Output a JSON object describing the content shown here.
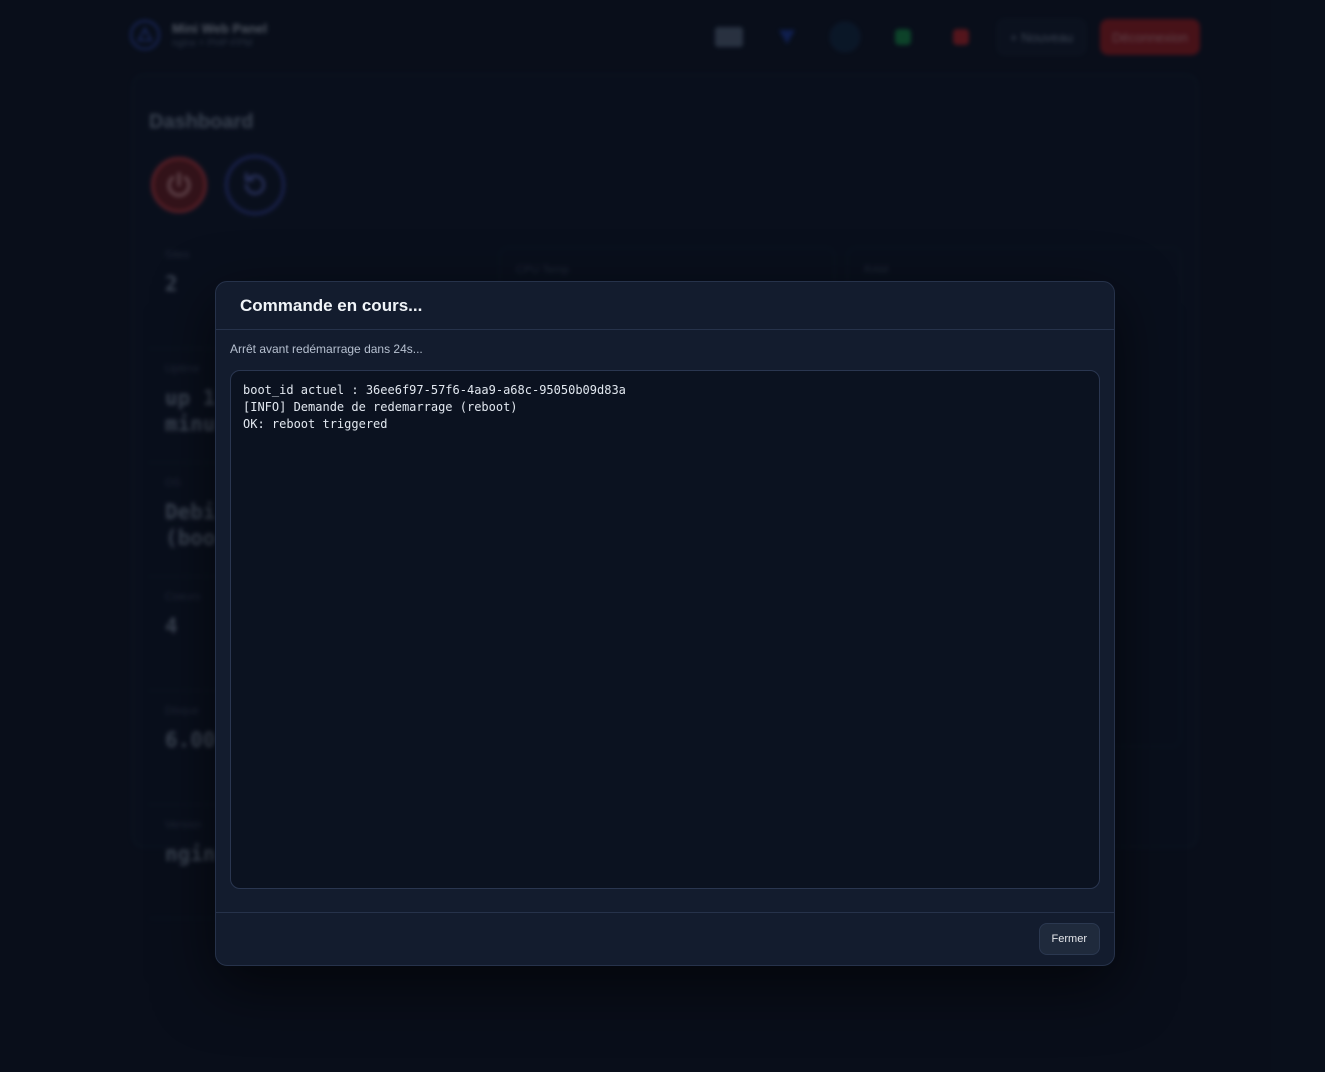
{
  "app": {
    "brand_title": "Mini Web Panel",
    "brand_subtitle": "nginx + PHP-FPM",
    "new_button": "+ Nouveau",
    "logout_button": "Déconnexion",
    "dashboard_title": "Dashboard",
    "cards": [
      {
        "label": "Sites",
        "value": "2"
      },
      {
        "label": "Uptime",
        "value": "up 1\nminu"
      },
      {
        "label": "OS",
        "value": "Debi\n(boo"
      },
      {
        "label": "Coeurs",
        "value": "4"
      },
      {
        "label": "Disque",
        "value": "6.00"
      },
      {
        "label": "Version",
        "value": "ngin"
      }
    ],
    "side_cards": [
      {
        "label": "CPU Temp"
      },
      {
        "label": "RAM"
      }
    ]
  },
  "modal": {
    "title": "Commande en cours...",
    "status": "Arrêt avant redémarrage dans 24s...",
    "console_lines": [
      "boot_id actuel : 36ee6f97-57f6-4aa9-a68c-95050b09d83a",
      "[INFO] Demande de redemarrage (reboot)",
      "OK: reboot triggered"
    ],
    "close_button": "Fermer"
  },
  "colors": {
    "background": "#0b1220",
    "modal_bg": "#131c2e",
    "danger": "#dc2626",
    "accent": "#3b4bb0"
  }
}
